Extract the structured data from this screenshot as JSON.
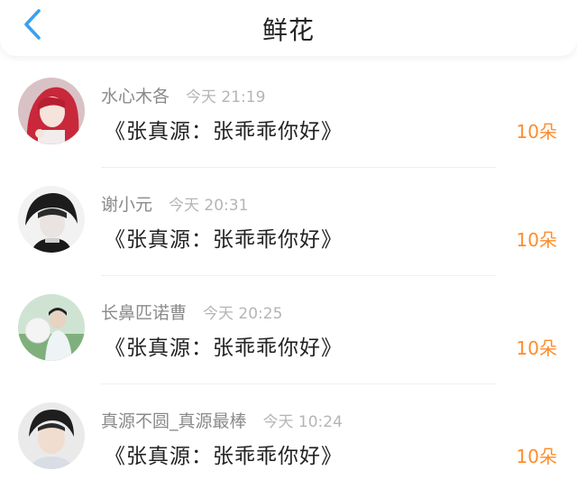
{
  "header": {
    "title": "鲜花",
    "back_icon": "chevron-left-icon",
    "accent_color": "#3aa0f0"
  },
  "records": [
    {
      "name": "水心木各",
      "time": "今天 21:19",
      "message": "《张真源：张乖乖你好》",
      "count": "10朵"
    },
    {
      "name": "谢小元",
      "time": "今天 20:31",
      "message": "《张真源：张乖乖你好》",
      "count": "10朵"
    },
    {
      "name": "长鼻匹诺曹",
      "time": "今天 20:25",
      "message": "《张真源：张乖乖你好》",
      "count": "10朵"
    },
    {
      "name": "真源不圆_真源最棒",
      "time": "今天 10:24",
      "message": "《张真源：张乖乖你好》",
      "count": "10朵"
    }
  ],
  "colors": {
    "count": "#ff8c2a",
    "name": "#8a8a8a",
    "time": "#b5b5b5"
  }
}
